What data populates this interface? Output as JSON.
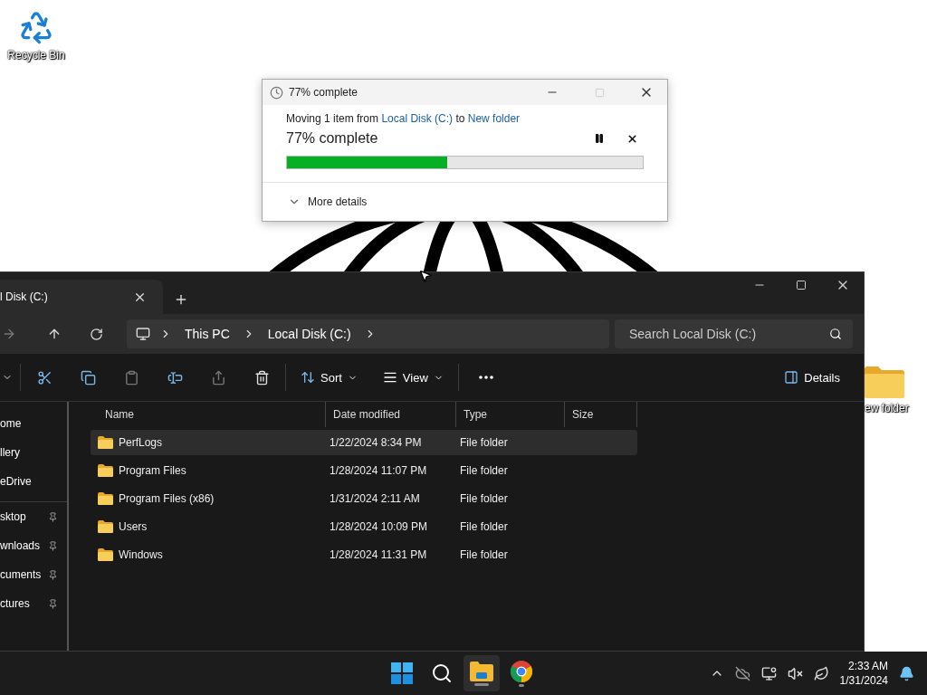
{
  "desktop_icons": [
    {
      "kind": "recycle",
      "label": "Recycle Bin"
    },
    {
      "kind": "folder",
      "label": "ew folder"
    }
  ],
  "progress_dialog": {
    "title": "77% complete",
    "message_prefix": "Moving 1 item from ",
    "source": "Local Disk (C:)",
    "message_mid": " to ",
    "destination": "New folder",
    "status": "77% complete",
    "level": 0.45,
    "more_details": "More details",
    "expanded": false
  },
  "explorer": {
    "tab": {
      "label": "l Disk (C:)",
      "selected": true
    },
    "breadcrumb": [
      "This PC",
      "Local Disk (C:)"
    ],
    "search": {
      "placeholder": "Search Local Disk (C:)"
    },
    "toolbar": {
      "sort": "Sort",
      "view": "View",
      "details": "Details"
    },
    "sidebar": [
      {
        "label": "ome",
        "pinned": false
      },
      {
        "label": "llery",
        "pinned": false
      },
      {
        "label": "eDrive",
        "pinned": false
      },
      {
        "label": "sktop",
        "pinned": true
      },
      {
        "label": "wnloads",
        "pinned": true
      },
      {
        "label": "cuments",
        "pinned": true
      },
      {
        "label": "ctures",
        "pinned": true
      }
    ],
    "columns": [
      "Name",
      "Date modified",
      "Type",
      "Size"
    ],
    "rows": [
      {
        "name": "PerfLogs",
        "date": "1/22/2024 8:34 PM",
        "type": "File folder",
        "selected": true
      },
      {
        "name": "Program Files",
        "date": "1/28/2024 11:07 PM",
        "type": "File folder",
        "selected": false
      },
      {
        "name": "Program Files (x86)",
        "date": "1/31/2024 2:11 AM",
        "type": "File folder",
        "selected": false
      },
      {
        "name": "Users",
        "date": "1/28/2024 10:09 PM",
        "type": "File folder",
        "selected": false
      },
      {
        "name": "Windows",
        "date": "1/28/2024 11:31 PM",
        "type": "File folder",
        "selected": false
      }
    ]
  },
  "taskbar": {
    "apps": [
      {
        "kind": "start",
        "selected": false
      },
      {
        "kind": "search",
        "selected": false
      },
      {
        "kind": "explorer",
        "selected": true
      },
      {
        "kind": "browser",
        "selected": false
      }
    ],
    "time": "2:33 AM",
    "date": "1/31/2024"
  }
}
